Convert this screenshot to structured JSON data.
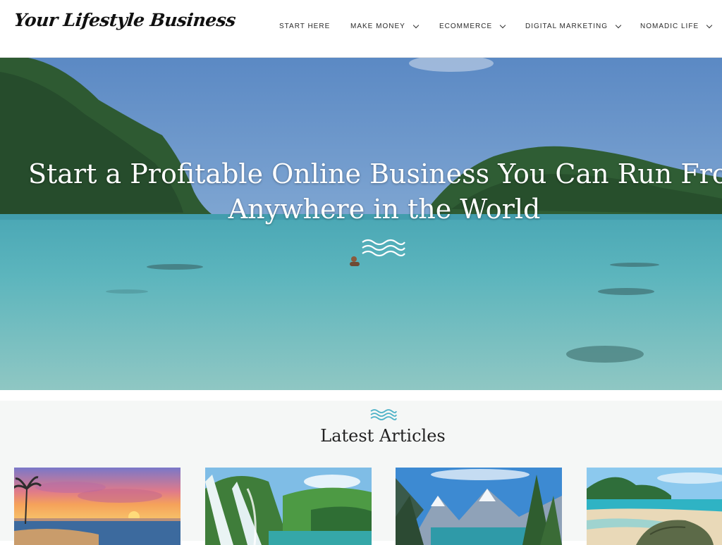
{
  "site": {
    "logo_text": "Your Lifestyle Business"
  },
  "nav": {
    "items": [
      {
        "label": "START HERE",
        "has_dropdown": false
      },
      {
        "label": "MAKE MONEY",
        "has_dropdown": true
      },
      {
        "label": "ECOMMERCE",
        "has_dropdown": true
      },
      {
        "label": "DIGITAL MARKETING",
        "has_dropdown": true
      },
      {
        "label": "NOMADIC LIFE",
        "has_dropdown": true
      }
    ]
  },
  "hero": {
    "title_line1": "Start a Profitable Online Business You Can Run From",
    "title_line2": "Anywhere in the World",
    "decor_icon": "waves-icon"
  },
  "latest": {
    "decor_icon": "waves-icon",
    "title": "Latest Articles",
    "accent_color": "#4fb3c8",
    "cards": [
      {
        "image": "sunset-beach-image"
      },
      {
        "image": "waterfall-image"
      },
      {
        "image": "mountain-lake-image"
      },
      {
        "image": "tropical-beach-image"
      }
    ]
  }
}
